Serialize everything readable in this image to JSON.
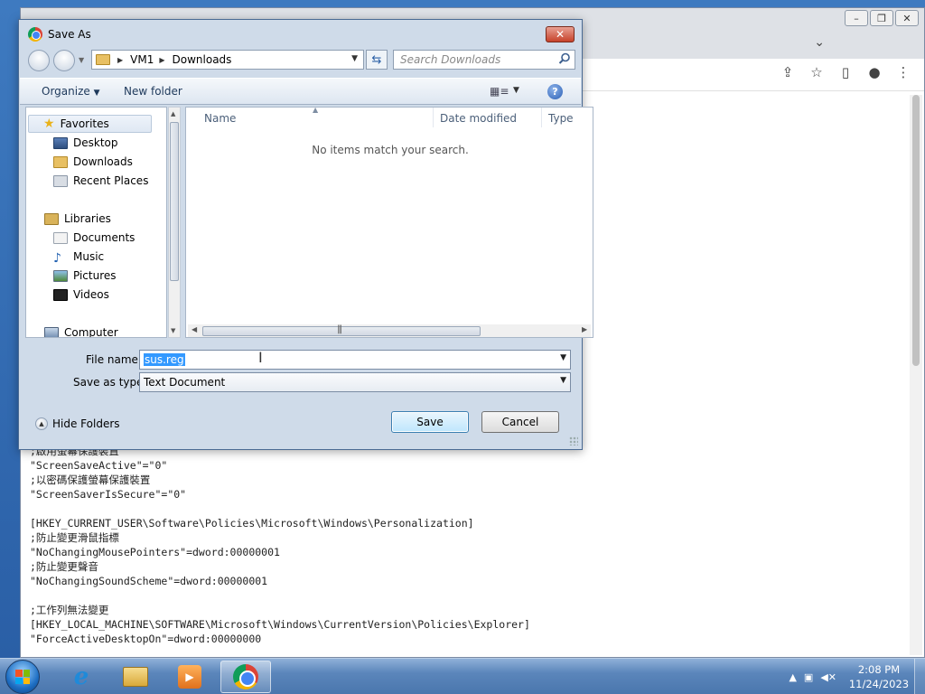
{
  "dialog": {
    "title": "Save As",
    "breadcrumb": [
      "VM1",
      "Downloads"
    ],
    "search_placeholder": "Search Downloads",
    "organize_label": "Organize",
    "new_folder_label": "New folder",
    "nav": {
      "favorites": "Favorites",
      "desktop": "Desktop",
      "downloads": "Downloads",
      "recent_places": "Recent Places",
      "libraries": "Libraries",
      "documents": "Documents",
      "music": "Music",
      "pictures": "Pictures",
      "videos": "Videos",
      "computer": "Computer"
    },
    "columns": {
      "name": "Name",
      "date_modified": "Date modified",
      "type": "Type"
    },
    "empty_message": "No items match your search.",
    "file_name_label": "File name:",
    "file_name_value": "sus.reg",
    "save_type_label": "Save as type:",
    "save_type_value": "Text Document",
    "hide_folders_label": "Hide Folders",
    "save_button": "Save",
    "cancel_button": "Cancel"
  },
  "page_text": [
    ";啟用螢幕保護裝置",
    "\"ScreenSaveActive\"=\"0\"",
    ";以密碼保護螢幕保護裝置",
    "\"ScreenSaverIsSecure\"=\"0\"",
    "",
    "[HKEY_CURRENT_USER\\Software\\Policies\\Microsoft\\Windows\\Personalization]",
    ";防止變更滑鼠指標",
    "\"NoChangingMousePointers\"=dword:00000001",
    ";防止變更聲音",
    "\"NoChangingSoundScheme\"=dword:00000001",
    "",
    ";工作列無法變更",
    "[HKEY_LOCAL_MACHINE\\SOFTWARE\\Microsoft\\Windows\\CurrentVersion\\Policies\\Explorer]",
    "\"ForceActiveDesktopOn\"=dword:00000000"
  ],
  "taskbar": {
    "time": "2:08 PM",
    "date": "11/24/2023"
  }
}
